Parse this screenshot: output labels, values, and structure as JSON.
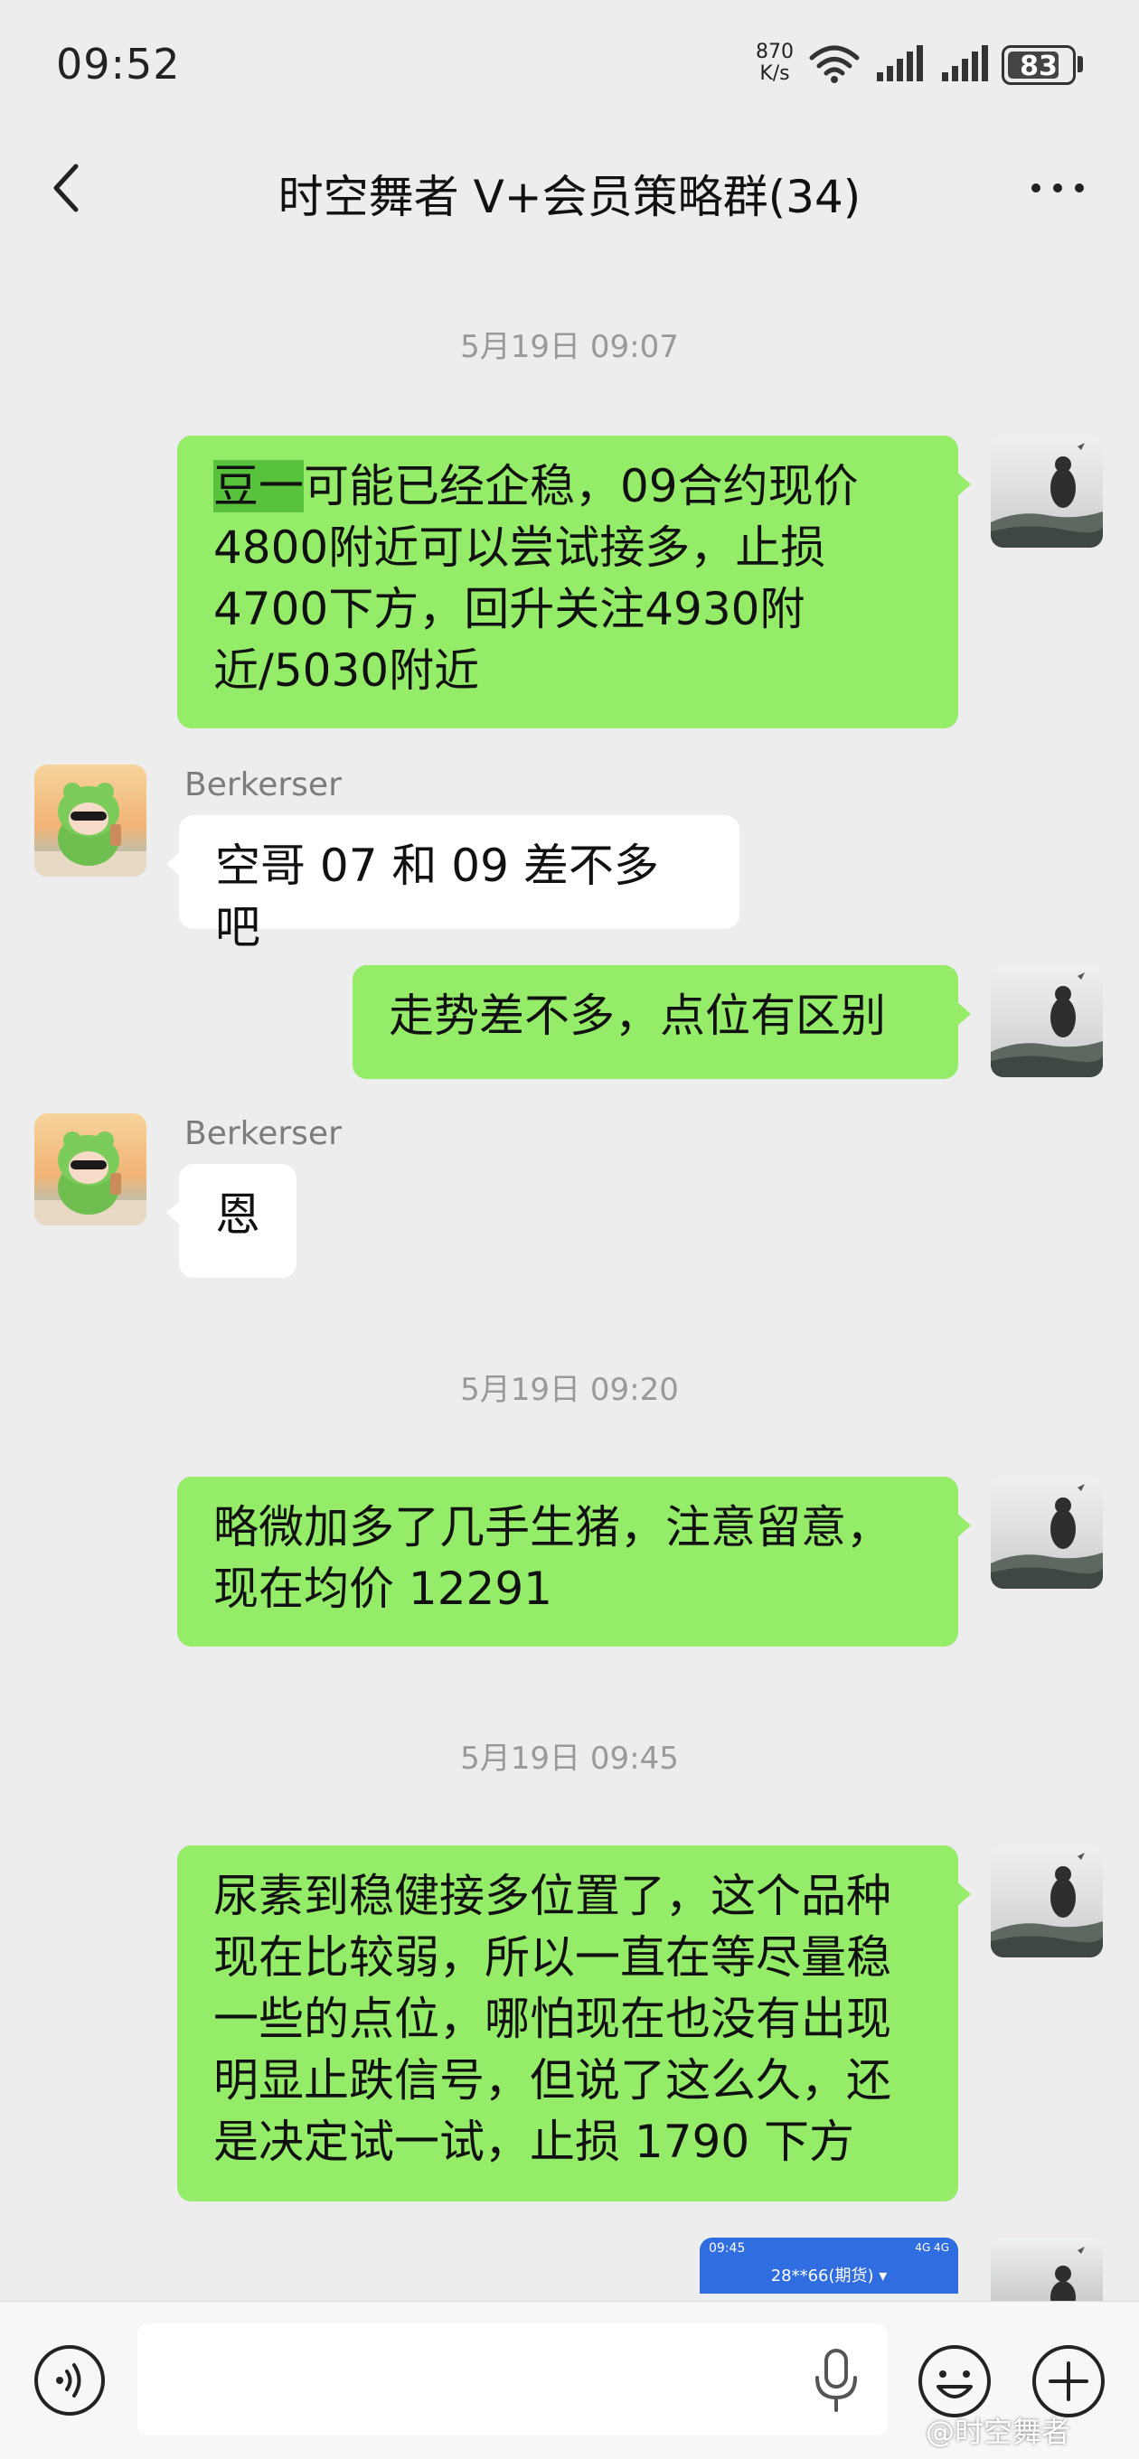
{
  "status_bar": {
    "time": "09:52",
    "net_speed_value": "870",
    "net_speed_unit": "K/s",
    "battery": "83",
    "battery_level": 0.83,
    "icons": [
      "wifi-icon",
      "signal-icon",
      "signal-icon"
    ]
  },
  "header": {
    "title": "时空舞者 V+会员策略群(34)",
    "back_icon": "chevron-left-icon",
    "more_icon": "more-dots-icon"
  },
  "messages": {
    "ts1": "5月19日 09:07",
    "m1_highlight": "豆一",
    "m1_rest": "可能已经企稳，09合约现价\n4800附近可以尝试接多，止损\n4700下方，回升关注4930附\n近/5030附近",
    "m2_sender": "Berkerser",
    "m2_text": "空哥 07 和 09 差不多吧",
    "m3_text": "走势差不多，点位有区别",
    "m4_sender": "Berkerser",
    "m4_text": "恩",
    "ts2": "5月19日 09:20",
    "m5_text": "略微加多了几手生猪，注意留意，\n现在均价 12291",
    "ts3": "5月19日 09:45",
    "m6_text": "尿素到稳健接多位置了，这个品种\n现在比较弱，所以一直在等尽量稳\n一些的点位，哪怕现在也没有出现\n明显止跌信号，但说了这么久，还\n是决定试一试，止损 1790 下方",
    "m7_image": {
      "time": "09:45",
      "status": "4G 4G",
      "title": "28**66(期货) ▾"
    }
  },
  "input_bar": {
    "placeholder": "",
    "value": "",
    "icons": [
      "voice-icon",
      "mic-icon",
      "emoji-icon",
      "plus-icon"
    ]
  },
  "watermark": "@时空舞者",
  "colors": {
    "background": "#ededed",
    "my_bubble": "#95ec69",
    "their_bubble": "#ffffff",
    "highlight": "#59c23c",
    "timestamp": "#999999"
  }
}
